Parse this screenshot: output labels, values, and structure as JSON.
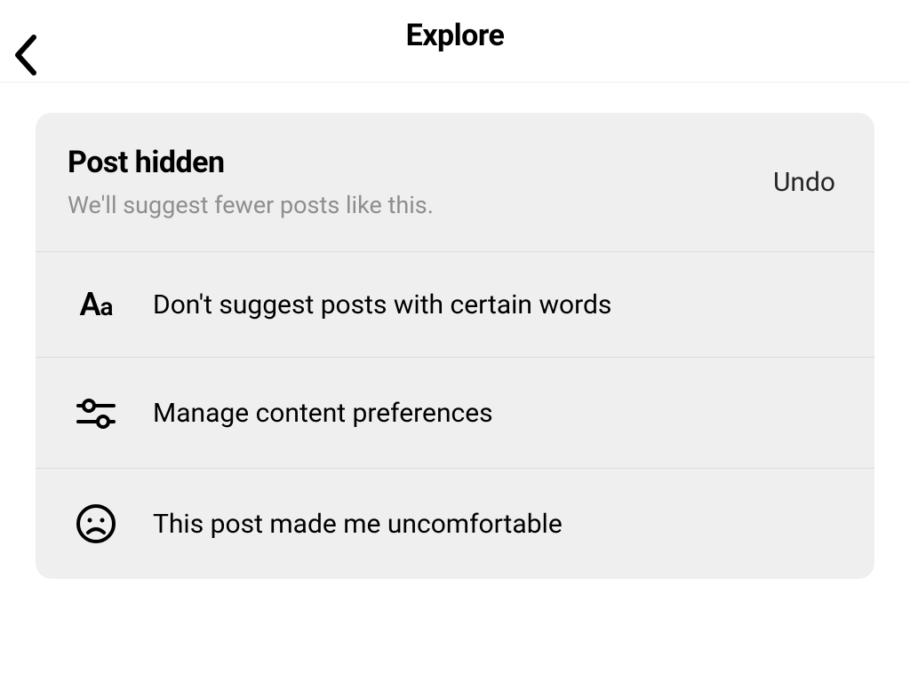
{
  "header": {
    "title": "Explore"
  },
  "card": {
    "title": "Post hidden",
    "subtitle": "We'll suggest fewer posts like this.",
    "undo_label": "Undo"
  },
  "options": [
    {
      "icon": "text-aa",
      "label": "Don't suggest posts with certain words"
    },
    {
      "icon": "sliders",
      "label": "Manage content preferences"
    },
    {
      "icon": "sad-face",
      "label": "This post made me uncomfortable"
    }
  ]
}
